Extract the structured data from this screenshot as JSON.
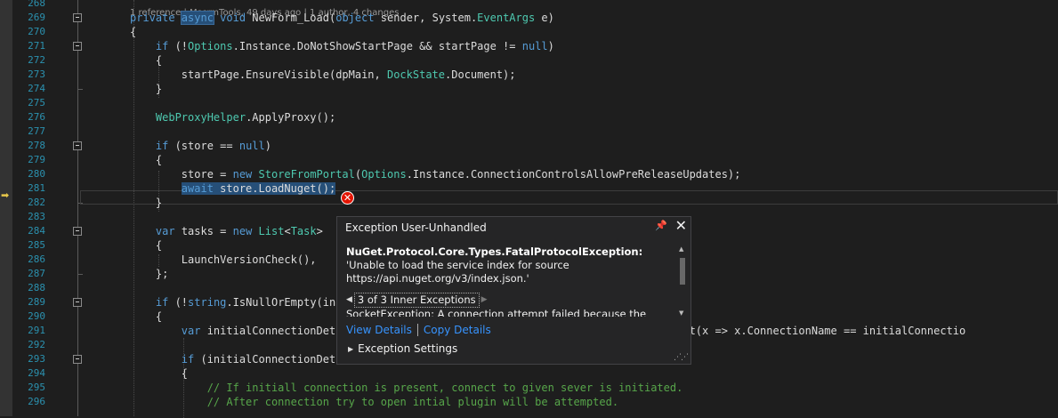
{
  "editor": {
    "codelens": "1 reference | MscrmTools, 49 days ago | 1 author, 4 changes",
    "line_numbers": [
      "268",
      "269",
      "270",
      "271",
      "272",
      "273",
      "274",
      "275",
      "276",
      "277",
      "278",
      "279",
      "280",
      "281",
      "282",
      "283",
      "284",
      "285",
      "286",
      "287",
      "288",
      "289",
      "290",
      "291",
      "292",
      "293",
      "294",
      "295",
      "296"
    ],
    "lines": [
      {
        "ln": "269",
        "tokens": [
          {
            "t": "private ",
            "c": "kw"
          },
          {
            "t": "async",
            "c": "kw",
            "h": 1
          },
          {
            "t": " "
          },
          {
            "t": "void",
            "c": "kw"
          },
          {
            "t": " NewForm_Load("
          },
          {
            "t": "object",
            "c": "kw"
          },
          {
            "t": " sender, System."
          },
          {
            "t": "EventArgs",
            "c": "ty"
          },
          {
            "t": " e)"
          }
        ]
      },
      {
        "ln": "270",
        "tokens": [
          {
            "t": "{"
          }
        ]
      },
      {
        "ln": "271",
        "tokens": [
          {
            "t": "    "
          },
          {
            "t": "if",
            "c": "kw"
          },
          {
            "t": " (!"
          },
          {
            "t": "Options",
            "c": "ty"
          },
          {
            "t": ".Instance.DoNotShowStartPage && startPage != "
          },
          {
            "t": "null",
            "c": "kw"
          },
          {
            "t": ")"
          }
        ]
      },
      {
        "ln": "272",
        "tokens": [
          {
            "t": "    {"
          }
        ]
      },
      {
        "ln": "273",
        "tokens": [
          {
            "t": "        startPage.EnsureVisible(dpMain, "
          },
          {
            "t": "DockState",
            "c": "ty"
          },
          {
            "t": ".Document);"
          }
        ]
      },
      {
        "ln": "274",
        "tokens": [
          {
            "t": "    }"
          }
        ]
      },
      {
        "ln": "275",
        "tokens": []
      },
      {
        "ln": "276",
        "tokens": [
          {
            "t": "    "
          },
          {
            "t": "WebProxyHelper",
            "c": "ty"
          },
          {
            "t": ".ApplyProxy();"
          }
        ]
      },
      {
        "ln": "277",
        "tokens": []
      },
      {
        "ln": "278",
        "tokens": [
          {
            "t": "    "
          },
          {
            "t": "if",
            "c": "kw"
          },
          {
            "t": " (store == "
          },
          {
            "t": "null",
            "c": "kw"
          },
          {
            "t": ")"
          }
        ]
      },
      {
        "ln": "279",
        "tokens": [
          {
            "t": "    {"
          }
        ]
      },
      {
        "ln": "280",
        "tokens": [
          {
            "t": "        store = "
          },
          {
            "t": "new",
            "c": "kw"
          },
          {
            "t": " "
          },
          {
            "t": "StoreFromPortal",
            "c": "ty"
          },
          {
            "t": "("
          },
          {
            "t": "Options",
            "c": "ty"
          },
          {
            "t": ".Instance.ConnectionControlsAllowPreReleaseUpdates);"
          }
        ]
      },
      {
        "ln": "281",
        "tokens": [
          {
            "t": "        "
          },
          {
            "t": "await",
            "c": "kw",
            "h": 2
          },
          {
            "t": " store.LoadNuget();",
            "h": 2
          }
        ]
      },
      {
        "ln": "282",
        "tokens": [
          {
            "t": "    }"
          }
        ]
      },
      {
        "ln": "283",
        "tokens": []
      },
      {
        "ln": "284",
        "tokens": [
          {
            "t": "    "
          },
          {
            "t": "var",
            "c": "kw"
          },
          {
            "t": " tasks = "
          },
          {
            "t": "new",
            "c": "kw"
          },
          {
            "t": " "
          },
          {
            "t": "List",
            "c": "ty"
          },
          {
            "t": "<"
          },
          {
            "t": "Task",
            "c": "ty"
          },
          {
            "t": ">"
          }
        ]
      },
      {
        "ln": "285",
        "tokens": [
          {
            "t": "    {"
          }
        ]
      },
      {
        "ln": "286",
        "tokens": [
          {
            "t": "        LaunchVersionCheck(),"
          }
        ]
      },
      {
        "ln": "287",
        "tokens": [
          {
            "t": "    };"
          }
        ]
      },
      {
        "ln": "288",
        "tokens": []
      },
      {
        "ln": "289",
        "tokens": [
          {
            "t": "    "
          },
          {
            "t": "if",
            "c": "kw"
          },
          {
            "t": " (!"
          },
          {
            "t": "string",
            "c": "kw"
          },
          {
            "t": ".IsNullOrEmpty(ini"
          }
        ]
      },
      {
        "ln": "290",
        "tokens": [
          {
            "t": "    {"
          }
        ]
      },
      {
        "ln": "291",
        "tokens": [
          {
            "t": "        "
          },
          {
            "t": "var",
            "c": "kw"
          },
          {
            "t": " initialConnectionDeta"
          },
          {
            "t": "                                      "
          },
          {
            "t": "ns.FirstOrDefault(x => x.ConnectionName == initialConnectio"
          }
        ]
      },
      {
        "ln": "292",
        "tokens": []
      },
      {
        "ln": "293",
        "tokens": [
          {
            "t": "        "
          },
          {
            "t": "if",
            "c": "kw"
          },
          {
            "t": " (initialConnectionDetail != "
          },
          {
            "t": "null",
            "c": "kw"
          },
          {
            "t": ")"
          }
        ]
      },
      {
        "ln": "294",
        "tokens": [
          {
            "t": "        {"
          }
        ]
      },
      {
        "ln": "295",
        "tokens": [
          {
            "t": "            "
          },
          {
            "t": "// If initiall connection is present, connect to given sever is initiated.",
            "c": "cm"
          }
        ]
      },
      {
        "ln": "296",
        "tokens": [
          {
            "t": "            "
          },
          {
            "t": "// After connection try to open intial plugin will be attempted.",
            "c": "cm"
          }
        ]
      }
    ]
  },
  "exception_popup": {
    "title": "Exception User-Unhandled",
    "exception_type": "NuGet.Protocol.Core.Types.FatalProtocolException:",
    "exception_message": " 'Unable to load the service index for source https://api.nuget.org/v3/index.json.'",
    "inner_exceptions_label": "3 of 3 Inner Exceptions",
    "inner_exception_message": "SocketException: A connection attempt failed because the",
    "view_details": "View Details",
    "copy_details": "Copy Details",
    "exception_settings": "Exception Settings"
  },
  "icons": {
    "pin": "pin-icon",
    "close": "close-icon",
    "error": "error-icon",
    "instruction_pointer": "arrow-icon"
  },
  "colors": {
    "keyword": "#569cd6",
    "type": "#4ec9b0",
    "comment": "#57a64a",
    "line_number": "#2b91af",
    "link": "#3794ff",
    "error": "#e51400"
  }
}
